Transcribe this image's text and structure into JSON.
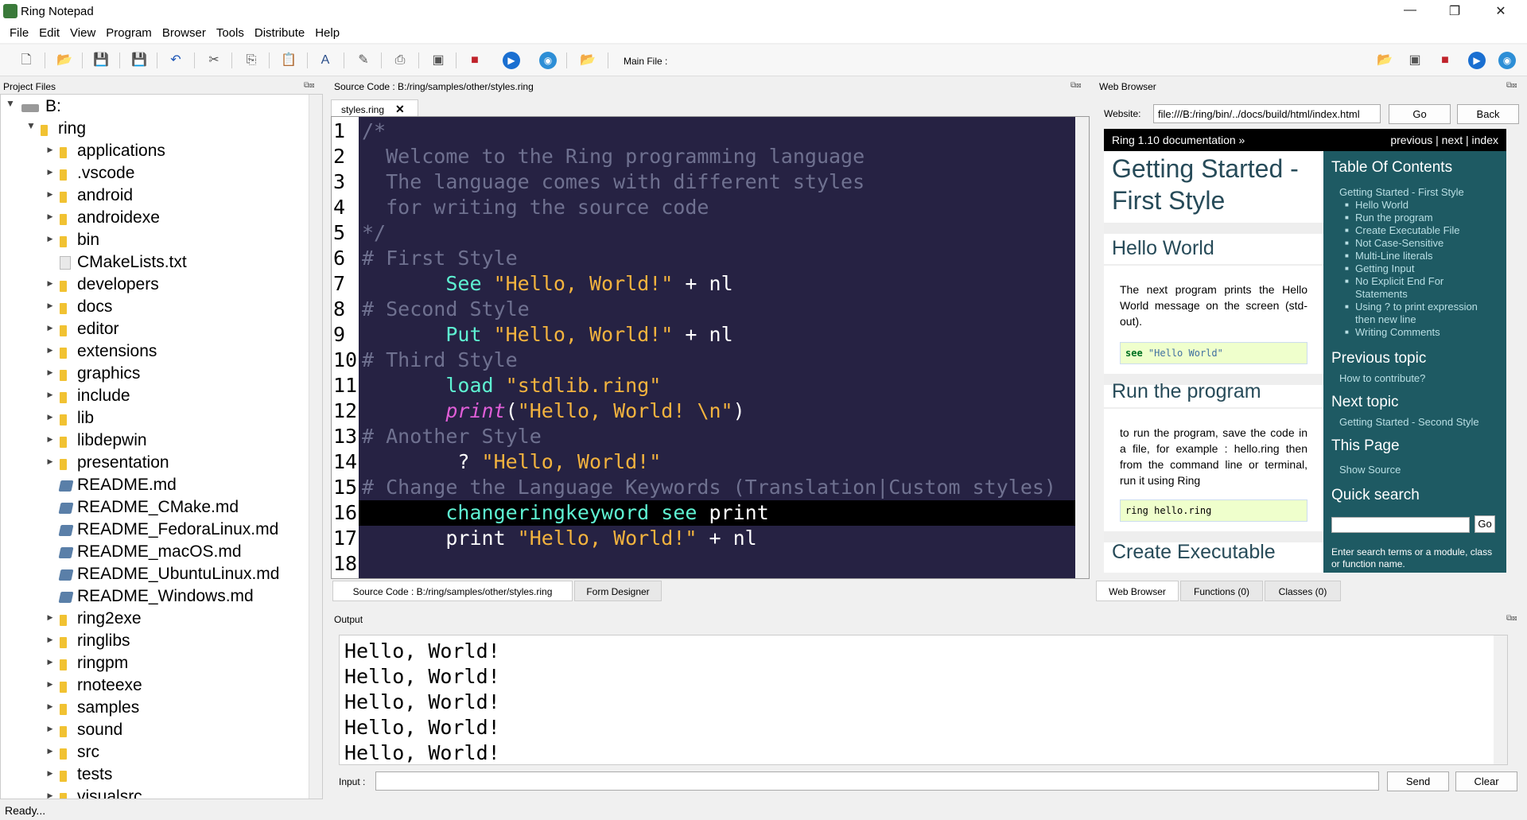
{
  "window": {
    "title": "Ring Notepad"
  },
  "menu": [
    "File",
    "Edit",
    "View",
    "Program",
    "Browser",
    "Tools",
    "Distribute",
    "Help"
  ],
  "toolbar": {
    "main_file_label": "Main File :"
  },
  "project_panel": {
    "title": "Project Files",
    "items": [
      {
        "label": "B:",
        "type": "drive",
        "depth": 0,
        "expanded": true
      },
      {
        "label": "ring",
        "type": "folder",
        "depth": 1,
        "expanded": true
      },
      {
        "label": "applications",
        "type": "folder",
        "depth": 2
      },
      {
        "label": ".vscode",
        "type": "folder",
        "depth": 2
      },
      {
        "label": "android",
        "type": "folder",
        "depth": 2
      },
      {
        "label": "androidexe",
        "type": "folder",
        "depth": 2
      },
      {
        "label": "bin",
        "type": "folder",
        "depth": 2
      },
      {
        "label": "CMakeLists.txt",
        "type": "file",
        "depth": 2
      },
      {
        "label": "developers",
        "type": "folder",
        "depth": 2
      },
      {
        "label": "docs",
        "type": "folder",
        "depth": 2
      },
      {
        "label": "editor",
        "type": "folder",
        "depth": 2
      },
      {
        "label": "extensions",
        "type": "folder",
        "depth": 2
      },
      {
        "label": "graphics",
        "type": "folder",
        "depth": 2
      },
      {
        "label": "include",
        "type": "folder",
        "depth": 2
      },
      {
        "label": "lib",
        "type": "folder",
        "depth": 2
      },
      {
        "label": "libdepwin",
        "type": "folder",
        "depth": 2
      },
      {
        "label": "presentation",
        "type": "folder",
        "depth": 2
      },
      {
        "label": "README.md",
        "type": "md",
        "depth": 2
      },
      {
        "label": "README_CMake.md",
        "type": "md",
        "depth": 2
      },
      {
        "label": "README_FedoraLinux.md",
        "type": "md",
        "depth": 2
      },
      {
        "label": "README_macOS.md",
        "type": "md",
        "depth": 2
      },
      {
        "label": "README_UbuntuLinux.md",
        "type": "md",
        "depth": 2
      },
      {
        "label": "README_Windows.md",
        "type": "md",
        "depth": 2
      },
      {
        "label": "ring2exe",
        "type": "folder",
        "depth": 2
      },
      {
        "label": "ringlibs",
        "type": "folder",
        "depth": 2
      },
      {
        "label": "ringpm",
        "type": "folder",
        "depth": 2
      },
      {
        "label": "rnoteexe",
        "type": "folder",
        "depth": 2
      },
      {
        "label": "samples",
        "type": "folder",
        "depth": 2
      },
      {
        "label": "sound",
        "type": "folder",
        "depth": 2
      },
      {
        "label": "src",
        "type": "folder",
        "depth": 2
      },
      {
        "label": "tests",
        "type": "folder",
        "depth": 2
      },
      {
        "label": "visualsrc",
        "type": "folder",
        "depth": 2
      }
    ]
  },
  "source_panel": {
    "title": "Source Code : B:/ring/samples/other/styles.ring",
    "tab": "styles.ring",
    "current_line": 16,
    "lines": [
      {
        "n": "1",
        "tokens": [
          [
            "cmt",
            "/*"
          ]
        ]
      },
      {
        "n": "2",
        "tokens": [
          [
            "cmt",
            "  Welcome to the Ring programming language"
          ]
        ]
      },
      {
        "n": "3",
        "tokens": [
          [
            "cmt",
            "  The language comes with different styles"
          ]
        ]
      },
      {
        "n": "4",
        "tokens": [
          [
            "cmt",
            "  for writing the source code"
          ]
        ]
      },
      {
        "n": "5",
        "tokens": [
          [
            "cmt",
            "*/"
          ]
        ]
      },
      {
        "n": "6",
        "tokens": [
          [
            "cmt",
            "# First Style"
          ]
        ]
      },
      {
        "n": "7",
        "tokens": [
          [
            "pl",
            "       "
          ],
          [
            "kw",
            "See"
          ],
          [
            "pl",
            " "
          ],
          [
            "str",
            "\"Hello, World!\""
          ],
          [
            "pl",
            " + nl"
          ]
        ]
      },
      {
        "n": "8",
        "tokens": [
          [
            "cmt",
            "# Second Style"
          ]
        ]
      },
      {
        "n": "9",
        "tokens": [
          [
            "pl",
            "       "
          ],
          [
            "kw",
            "Put"
          ],
          [
            "pl",
            " "
          ],
          [
            "str",
            "\"Hello, World!\""
          ],
          [
            "pl",
            " + nl"
          ]
        ]
      },
      {
        "n": "10",
        "tokens": [
          [
            "cmt",
            "# Third Style"
          ]
        ]
      },
      {
        "n": "11",
        "tokens": [
          [
            "pl",
            "       "
          ],
          [
            "kw",
            "load"
          ],
          [
            "pl",
            " "
          ],
          [
            "str",
            "\"stdlib.ring\""
          ]
        ]
      },
      {
        "n": "12",
        "tokens": [
          [
            "pl",
            "       "
          ],
          [
            "fn",
            "print"
          ],
          [
            "pl",
            "("
          ],
          [
            "str",
            "\"Hello, World! \\n\""
          ],
          [
            "pl",
            ")"
          ]
        ]
      },
      {
        "n": "13",
        "tokens": [
          [
            "cmt",
            "# Another Style"
          ]
        ]
      },
      {
        "n": "14",
        "tokens": [
          [
            "pl",
            "        ? "
          ],
          [
            "str",
            "\"Hello, World!\""
          ]
        ]
      },
      {
        "n": "15",
        "tokens": [
          [
            "cmt",
            "# Change the Language Keywords (Translation|Custom styles)"
          ]
        ]
      },
      {
        "n": "16",
        "tokens": [
          [
            "pl",
            "       "
          ],
          [
            "kw",
            "changeringkeyword"
          ],
          [
            "pl",
            " "
          ],
          [
            "kw",
            "see"
          ],
          [
            "pl",
            " print"
          ]
        ]
      },
      {
        "n": "17",
        "tokens": [
          [
            "pl",
            "       print "
          ],
          [
            "str",
            "\"Hello, World!\""
          ],
          [
            "pl",
            " + nl"
          ]
        ]
      },
      {
        "n": "18",
        "tokens": []
      }
    ],
    "bottom_tabs": [
      "Source Code : B:/ring/samples/other/styles.ring",
      "Form Designer"
    ]
  },
  "web_panel": {
    "title": "Web Browser",
    "website_label": "Website:",
    "url": "file:///B:/ring/bin/../docs/build/html/index.html",
    "go_label": "Go",
    "back_label": "Back",
    "doc": {
      "header": "Ring 1.10 documentation »",
      "nav": "previous | next | index",
      "h1_line1": "Getting Started -",
      "h1_line2": "First Style",
      "hello_heading": "Hello World",
      "hello_text": "The next program prints the Hello World message on the screen (std-out).",
      "hello_code_kw": "see",
      "hello_code_str": "\"Hello World\"",
      "run_heading": "Run the program",
      "run_text": "to run the program, save the code in a file, for example : hello.ring then from the command line or terminal, run it using Ring",
      "run_code": "ring hello.ring",
      "create_heading": "Create Executable",
      "toc_heading": "Table Of Contents",
      "toc_top": "Getting Started - First Style",
      "toc_items": [
        "Hello World",
        "Run the program",
        "Create Executable File",
        "Not Case-Sensitive",
        "Multi-Line literals",
        "Getting Input",
        "No Explicit End For Statements",
        "Using ? to print expression then new line",
        "Writing Comments"
      ],
      "prev_heading": "Previous topic",
      "prev_link": "How to contribute?",
      "next_heading": "Next topic",
      "next_link": "Getting Started - Second Style",
      "this_page_heading": "This Page",
      "show_source": "Show Source",
      "quick_search_heading": "Quick search",
      "search_go": "Go",
      "search_hint": "Enter search terms or a module, class or function name."
    },
    "bottom_tabs": [
      "Web Browser",
      "Functions (0)",
      "Classes (0)"
    ]
  },
  "output_panel": {
    "title": "Output",
    "lines": [
      "Hello, World!",
      "Hello, World!",
      "Hello, World!",
      "Hello, World!",
      "Hello, World!"
    ],
    "input_label": "Input :",
    "send_label": "Send",
    "clear_label": "Clear"
  },
  "status": {
    "text": "Ready..."
  }
}
